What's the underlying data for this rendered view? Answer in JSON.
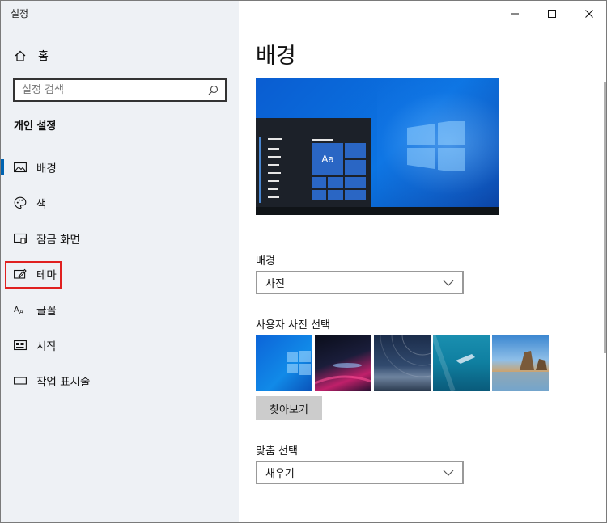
{
  "window": {
    "title": "설정"
  },
  "sidebar": {
    "home_label": "홈",
    "search_placeholder": "설정 검색",
    "section_title": "개인 설정",
    "items": [
      {
        "label": "배경",
        "icon": "picture-icon",
        "selected": true
      },
      {
        "label": "색",
        "icon": "palette-icon",
        "selected": false
      },
      {
        "label": "잠금 화면",
        "icon": "lock-screen-icon",
        "selected": false
      },
      {
        "label": "테마",
        "icon": "theme-icon",
        "selected": false,
        "highlighted": true
      },
      {
        "label": "글꼴",
        "icon": "font-icon",
        "selected": false
      },
      {
        "label": "시작",
        "icon": "start-icon",
        "selected": false
      },
      {
        "label": "작업 표시줄",
        "icon": "taskbar-icon",
        "selected": false
      }
    ]
  },
  "main": {
    "page_title": "배경",
    "preview_tile_text": "Aa",
    "background_label": "배경",
    "background_value": "사진",
    "choose_picture_label": "사용자 사진 선택",
    "thumbnails": [
      "windows-hero-thumbnail",
      "night-light-thumbnail",
      "star-trail-thumbnail",
      "underwater-swimmer-thumbnail",
      "beach-rocks-thumbnail"
    ],
    "browse_label": "찾아보기",
    "fit_label": "맞춤 선택",
    "fit_value": "채우기"
  },
  "colors": {
    "accent": "#0063b1",
    "highlight_box": "#e02020",
    "sidebar_bg": "#eef1f5"
  }
}
